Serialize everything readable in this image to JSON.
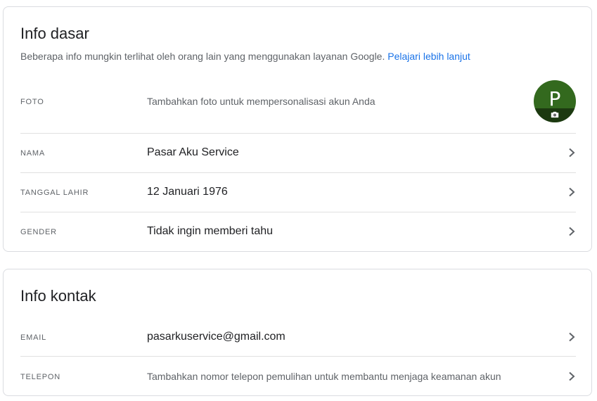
{
  "basic_info": {
    "title": "Info dasar",
    "description": "Beberapa info mungkin terlihat oleh orang lain yang menggunakan layanan Google.",
    "learn_more": "Pelajari lebih lanjut",
    "photo": {
      "label": "FOTO",
      "value": "Tambahkan foto untuk mempersonalisasi akun Anda",
      "avatar_letter": "P",
      "avatar_color": "#33691e"
    },
    "name": {
      "label": "NAMA",
      "value": "Pasar Aku Service"
    },
    "birthday": {
      "label": "TANGGAL LAHIR",
      "value": "12 Januari 1976"
    },
    "gender": {
      "label": "GENDER",
      "value": "Tidak ingin memberi tahu"
    }
  },
  "contact_info": {
    "title": "Info kontak",
    "email": {
      "label": "EMAIL",
      "value": "pasarkuservice@gmail.com"
    },
    "phone": {
      "label": "TELEPON",
      "value": "Tambahkan nomor telepon pemulihan untuk membantu menjaga keamanan akun"
    }
  },
  "colors": {
    "link": "#1a73e8",
    "border": "#dadce0"
  }
}
